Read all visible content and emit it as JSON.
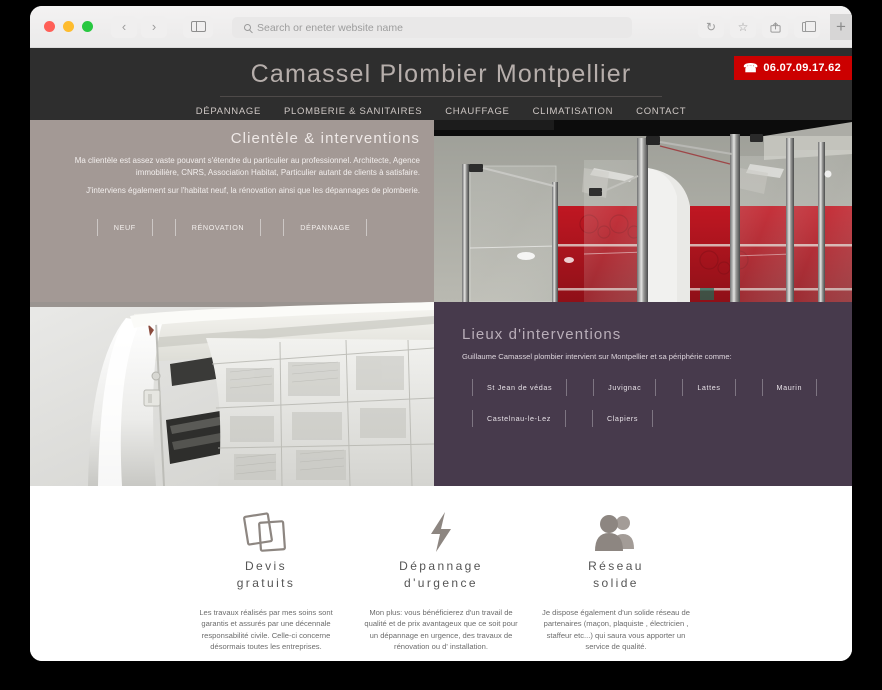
{
  "browser": {
    "search_placeholder": "Search or eneter website name",
    "back_label": "‹",
    "forward_label": "›",
    "reload_label": "↻",
    "star_label": "☆",
    "plus_label": "+"
  },
  "site": {
    "title": "Camassel Plombier Montpellier",
    "nav": [
      {
        "label": "DÉPANNAGE"
      },
      {
        "label": "PLOMBERIE & SANITAIRES"
      },
      {
        "label": "CHAUFFAGE"
      },
      {
        "label": "CLIMATISATION"
      },
      {
        "label": "CONTACT"
      }
    ],
    "phone": "06.07.09.17.62",
    "phone_icon": "☎",
    "accent_red": "#cc0000",
    "header_bg": "#2e2e2e",
    "taupe_bg": "#a39995",
    "plum_bg": "#473a4c"
  },
  "clientele": {
    "title": "Clientèle & interventions",
    "paragraph1": "Ma clientèle est assez vaste pouvant s'étendre du particulier au professionnel. Architecte, Agence immobilière, CNRS, Association Habitat, Particulier autant de clients à satisfaire.",
    "paragraph2": "J'interviens également sur l'habitat neuf, la rénovation ainsi que les dépannages de plomberie.",
    "tags": [
      {
        "label": "NEUF"
      },
      {
        "label": "RÉNOVATION"
      },
      {
        "label": "DÉPANNAGE"
      }
    ]
  },
  "lieux": {
    "title": "Lieux d'interventions",
    "subtitle": "Guillaume Camassel plombier intervient sur Montpellier et sa périphérie comme:",
    "tags_row1": [
      {
        "label": "St Jean de védas"
      },
      {
        "label": "Juvignac"
      },
      {
        "label": "Lattes"
      },
      {
        "label": "Maurin"
      }
    ],
    "tags_row2": [
      {
        "label": "Castelnau-le-Lez"
      },
      {
        "label": "Clapiers"
      }
    ]
  },
  "features": [
    {
      "icon": "documents-icon",
      "title_line1": "Devis",
      "title_line2": "gratuits",
      "text": "Les travaux réalisés par mes soins sont garantis et assurés par une décennale responsabilité civile. Celle-ci concerne désormais toutes les entreprises."
    },
    {
      "icon": "lightning-bolt-icon",
      "title_line1": "Dépannage",
      "title_line2": "d'urgence",
      "text": "Mon plus: vous bénéficierez d'un travail de qualité et de prix avantageux que ce soit pour un dépannage en urgence, des travaux de rénovation ou d' installation."
    },
    {
      "icon": "people-icon",
      "title_line1": "Réseau",
      "title_line2": "solide",
      "text": "Je dispose également d'un solide réseau de partenaires (maçon, plaquiste , électricien , staffeur etc...) qui saura vous apporter un service de qualité."
    }
  ],
  "photos": {
    "shower": "bathroom-shower-glass-panels-red-tiles",
    "ac": "wall-mounted-air-conditioner-unit"
  }
}
